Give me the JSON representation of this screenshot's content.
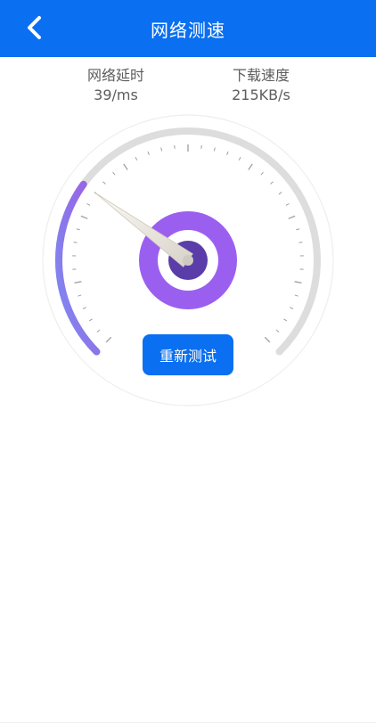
{
  "header": {
    "title": "网络测速",
    "background": "#0a6ff0",
    "back_icon": "chevron-left-icon"
  },
  "metrics": {
    "latency": {
      "label": "网络延时",
      "value": "39/ms"
    },
    "download": {
      "label": "下载速度",
      "value": "215KB/s"
    }
  },
  "gauge": {
    "progress_fraction": 0.3,
    "track_color": "#dddddd",
    "arc_start_color": "#7c8cf0",
    "arc_end_color": "#9d5ee5",
    "hub_outer_color": "#9b5ff0",
    "hub_inner_color": "#5a3da8"
  },
  "actions": {
    "retest_label": "重新测试"
  }
}
